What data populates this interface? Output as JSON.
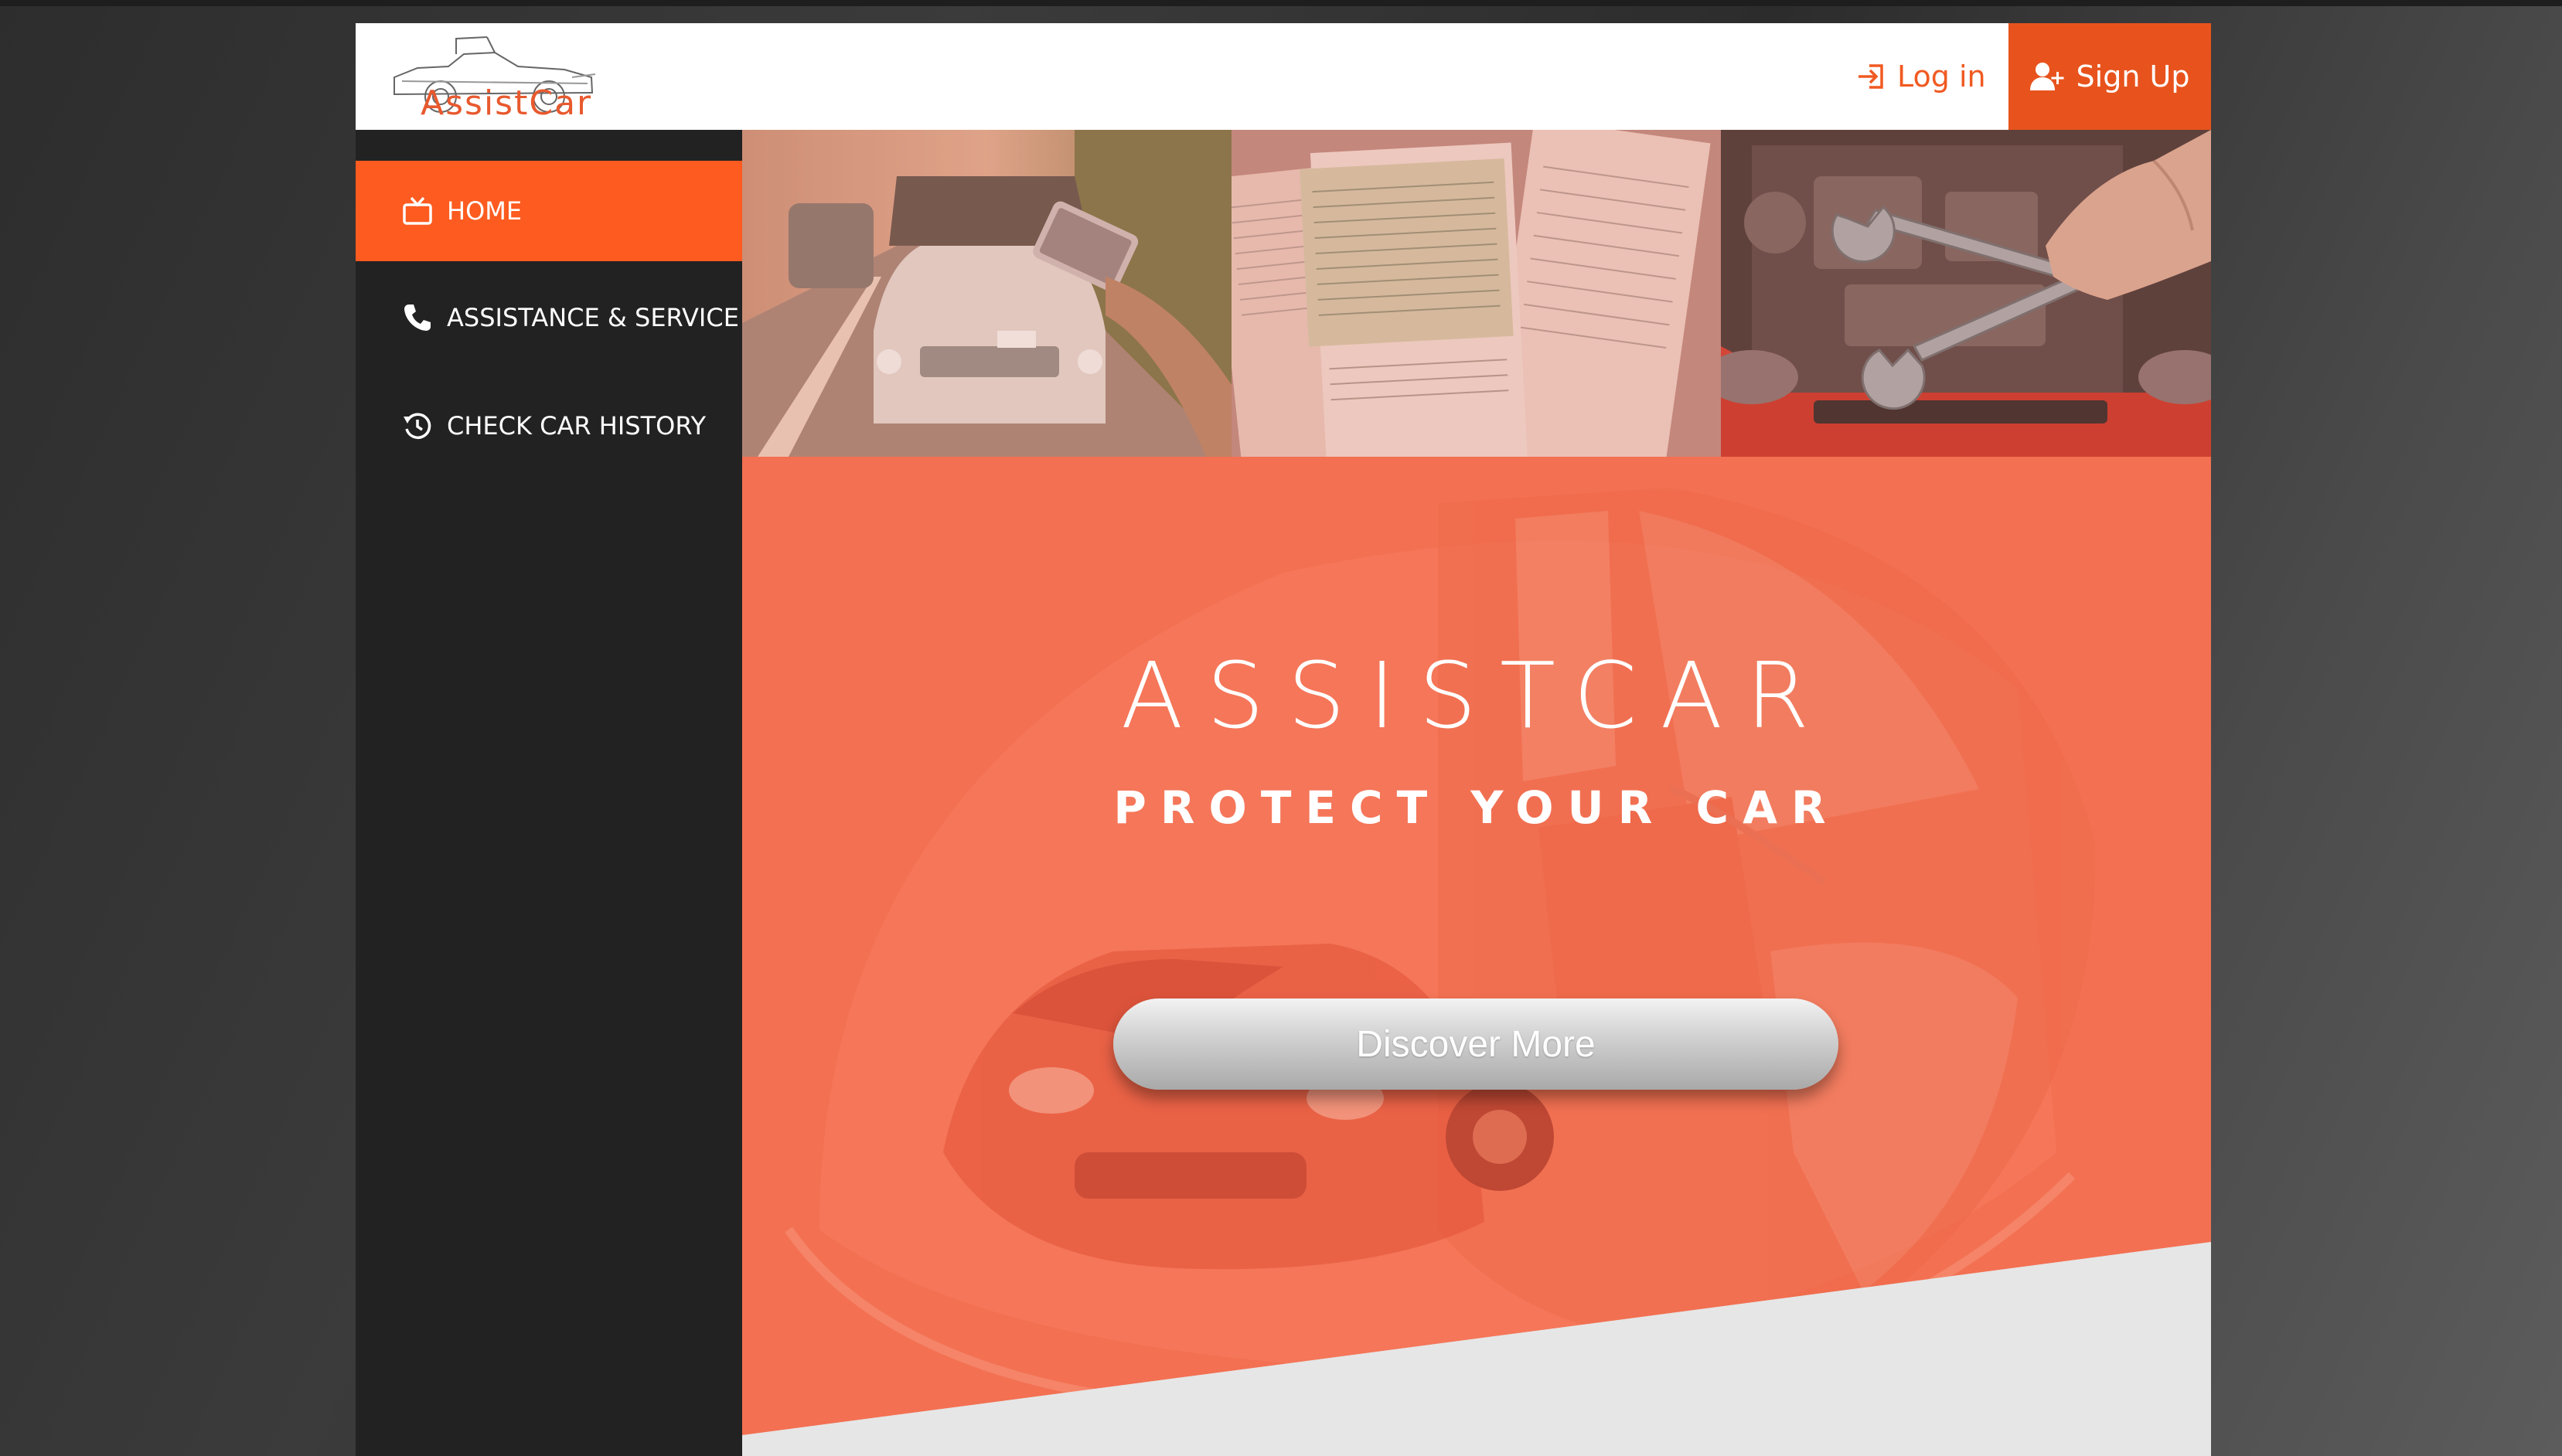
{
  "brand": {
    "logo_text": "AssistCar"
  },
  "header": {
    "login_label": "Log in",
    "signup_label": "Sign Up"
  },
  "sidebar": {
    "items": [
      {
        "label": "HOME",
        "icon": "tv-icon",
        "active": true
      },
      {
        "label": "ASSISTANCE & SERVICE",
        "icon": "phone-icon",
        "active": false
      },
      {
        "label": "CHECK CAR HISTORY",
        "icon": "history-icon",
        "active": false
      }
    ]
  },
  "photos": [
    {
      "subject": "broken-down-car-with-phone"
    },
    {
      "subject": "car-documents"
    },
    {
      "subject": "engine-with-wrenches"
    }
  ],
  "hero": {
    "title": "ASSISTCAR",
    "subtitle": "PROTECT YOUR CAR",
    "cta_label": "Discover More"
  },
  "colors": {
    "accent": "#fd5b1f",
    "hero_overlay": "#f37052",
    "sidebar_bg": "#222222",
    "header_bg": "#ffffff"
  }
}
